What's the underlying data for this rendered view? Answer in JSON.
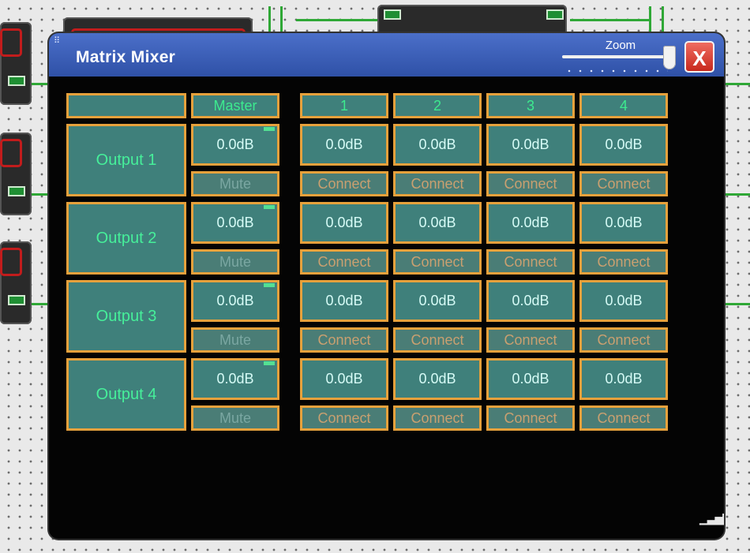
{
  "window": {
    "title": "Matrix Mixer",
    "grip_icon": "grip-dots-icon",
    "zoom_label": "Zoom",
    "zoom_level": 0.95,
    "close_label": "X"
  },
  "colors": {
    "titlebar": "#3a5db8",
    "cell_fill": "#3f807b",
    "cell_border": "#e6a13c",
    "label_green": "#46ef9a",
    "wire_green": "#2fa836",
    "close_red": "#d63a2e"
  },
  "mixer": {
    "corner_label": "",
    "master_label": "Master",
    "inputs": [
      "1",
      "2",
      "3",
      "4"
    ],
    "outputs": [
      {
        "label": "Output 1",
        "master_level": "0.0dB",
        "mute_label": "Mute",
        "levels": [
          "0.0dB",
          "0.0dB",
          "0.0dB",
          "0.0dB"
        ],
        "connect": [
          "Connect",
          "Connect",
          "Connect",
          "Connect"
        ]
      },
      {
        "label": "Output 2",
        "master_level": "0.0dB",
        "mute_label": "Mute",
        "levels": [
          "0.0dB",
          "0.0dB",
          "0.0dB",
          "0.0dB"
        ],
        "connect": [
          "Connect",
          "Connect",
          "Connect",
          "Connect"
        ]
      },
      {
        "label": "Output 3",
        "master_level": "0.0dB",
        "mute_label": "Mute",
        "levels": [
          "0.0dB",
          "0.0dB",
          "0.0dB",
          "0.0dB"
        ],
        "connect": [
          "Connect",
          "Connect",
          "Connect",
          "Connect"
        ]
      },
      {
        "label": "Output 4",
        "master_level": "0.0dB",
        "mute_label": "Mute",
        "levels": [
          "0.0dB",
          "0.0dB",
          "0.0dB",
          "0.0dB"
        ],
        "connect": [
          "Connect",
          "Connect",
          "Connect",
          "Connect"
        ]
      }
    ]
  }
}
